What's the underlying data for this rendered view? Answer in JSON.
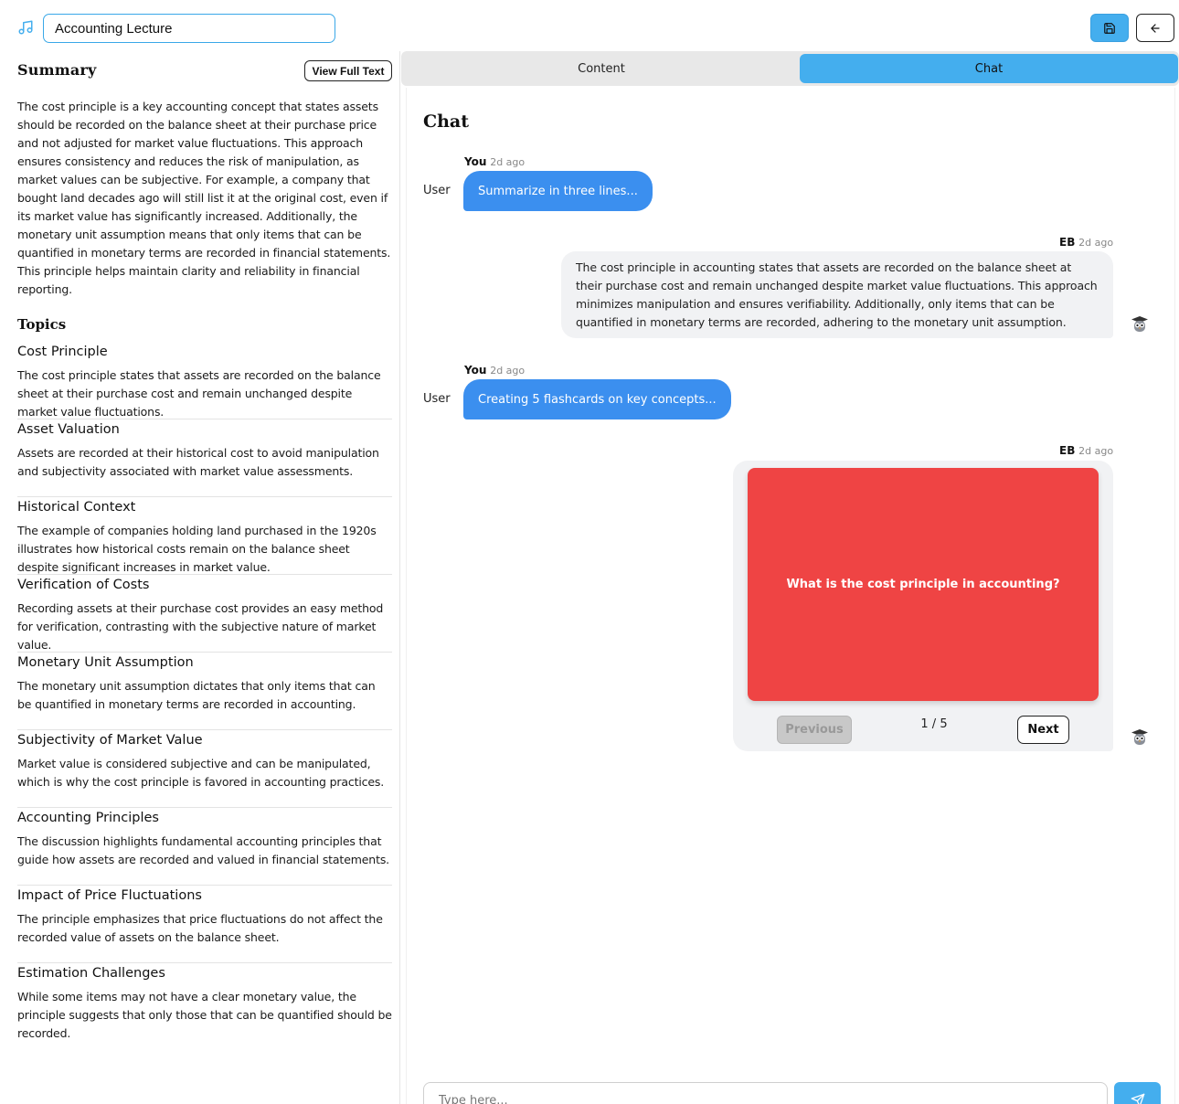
{
  "header": {
    "title_value": "Accounting Lecture",
    "icons": {
      "app": "music-note-icon",
      "save": "save-icon",
      "back": "arrow-left-icon"
    },
    "accent_color": "#44aeee"
  },
  "summary": {
    "heading": "Summary",
    "view_full_label": "View Full Text",
    "text": "The cost principle is a key accounting concept that states assets should be recorded on the balance sheet at their purchase price and not adjusted for market value fluctuations. This approach ensures consistency and reduces the risk of manipulation, as market values can be subjective. For example, a company that bought land decades ago will still list it at the original cost, even if its market value has significantly increased. Additionally, the monetary unit assumption means that only items that can be quantified in monetary terms are recorded in financial statements. This principle helps maintain clarity and reliability in financial reporting."
  },
  "topics": {
    "heading": "Topics",
    "items": [
      {
        "title": "Cost Principle",
        "desc": "The cost principle states that assets are recorded on the balance sheet at their purchase cost and remain unchanged despite market value fluctuations."
      },
      {
        "title": "Asset Valuation",
        "desc": "Assets are recorded at their historical cost to avoid manipulation and subjectivity associated with market value assessments."
      },
      {
        "title": "Historical Context",
        "desc": "The example of companies holding land purchased in the 1920s illustrates how historical costs remain on the balance sheet despite significant increases in market value."
      },
      {
        "title": "Verification of Costs",
        "desc": "Recording assets at their purchase cost provides an easy method for verification, contrasting with the subjective nature of market value."
      },
      {
        "title": "Monetary Unit Assumption",
        "desc": "The monetary unit assumption dictates that only items that can be quantified in monetary terms are recorded in accounting."
      },
      {
        "title": "Subjectivity of Market Value",
        "desc": "Market value is considered subjective and can be manipulated, which is why the cost principle is favored in accounting practices."
      },
      {
        "title": "Accounting Principles",
        "desc": "The discussion highlights fundamental accounting principles that guide how assets are recorded and valued in financial statements."
      },
      {
        "title": "Impact of Price Fluctuations",
        "desc": "The principle emphasizes that price fluctuations do not affect the recorded value of assets on the balance sheet."
      },
      {
        "title": "Estimation Challenges",
        "desc": "While some items may not have a clear monetary value, the principle suggests that only those that can be quantified should be recorded."
      }
    ]
  },
  "tabs": {
    "content": "Content",
    "chat": "Chat"
  },
  "chat": {
    "heading": "Chat",
    "messages": [
      {
        "who": "You",
        "when": "2d ago",
        "label": "User",
        "text": "Summarize in three lines..."
      },
      {
        "who": "EB",
        "when": "2d ago",
        "text": "The cost principle in accounting states that assets are recorded on the balance sheet at their purchase cost and remain unchanged despite market value fluctuations. This approach minimizes manipulation and ensures verifiability. Additionally, only items that can be quantified in monetary terms are recorded, adhering to the monetary unit assumption."
      },
      {
        "who": "You",
        "when": "2d ago",
        "label": "User",
        "text": "Creating 5 flashcards on key concepts..."
      },
      {
        "who": "EB",
        "when": "2d ago"
      }
    ],
    "flashcard": {
      "question": "What is the cost principle in accounting?",
      "prev_label": "Previous",
      "next_label": "Next",
      "counter": "1 / 5",
      "card_color": "#ef4444"
    },
    "input_placeholder": "Type here...",
    "bot_avatar_icon": "owl-graduate-icon",
    "send_icon": "send-icon"
  }
}
